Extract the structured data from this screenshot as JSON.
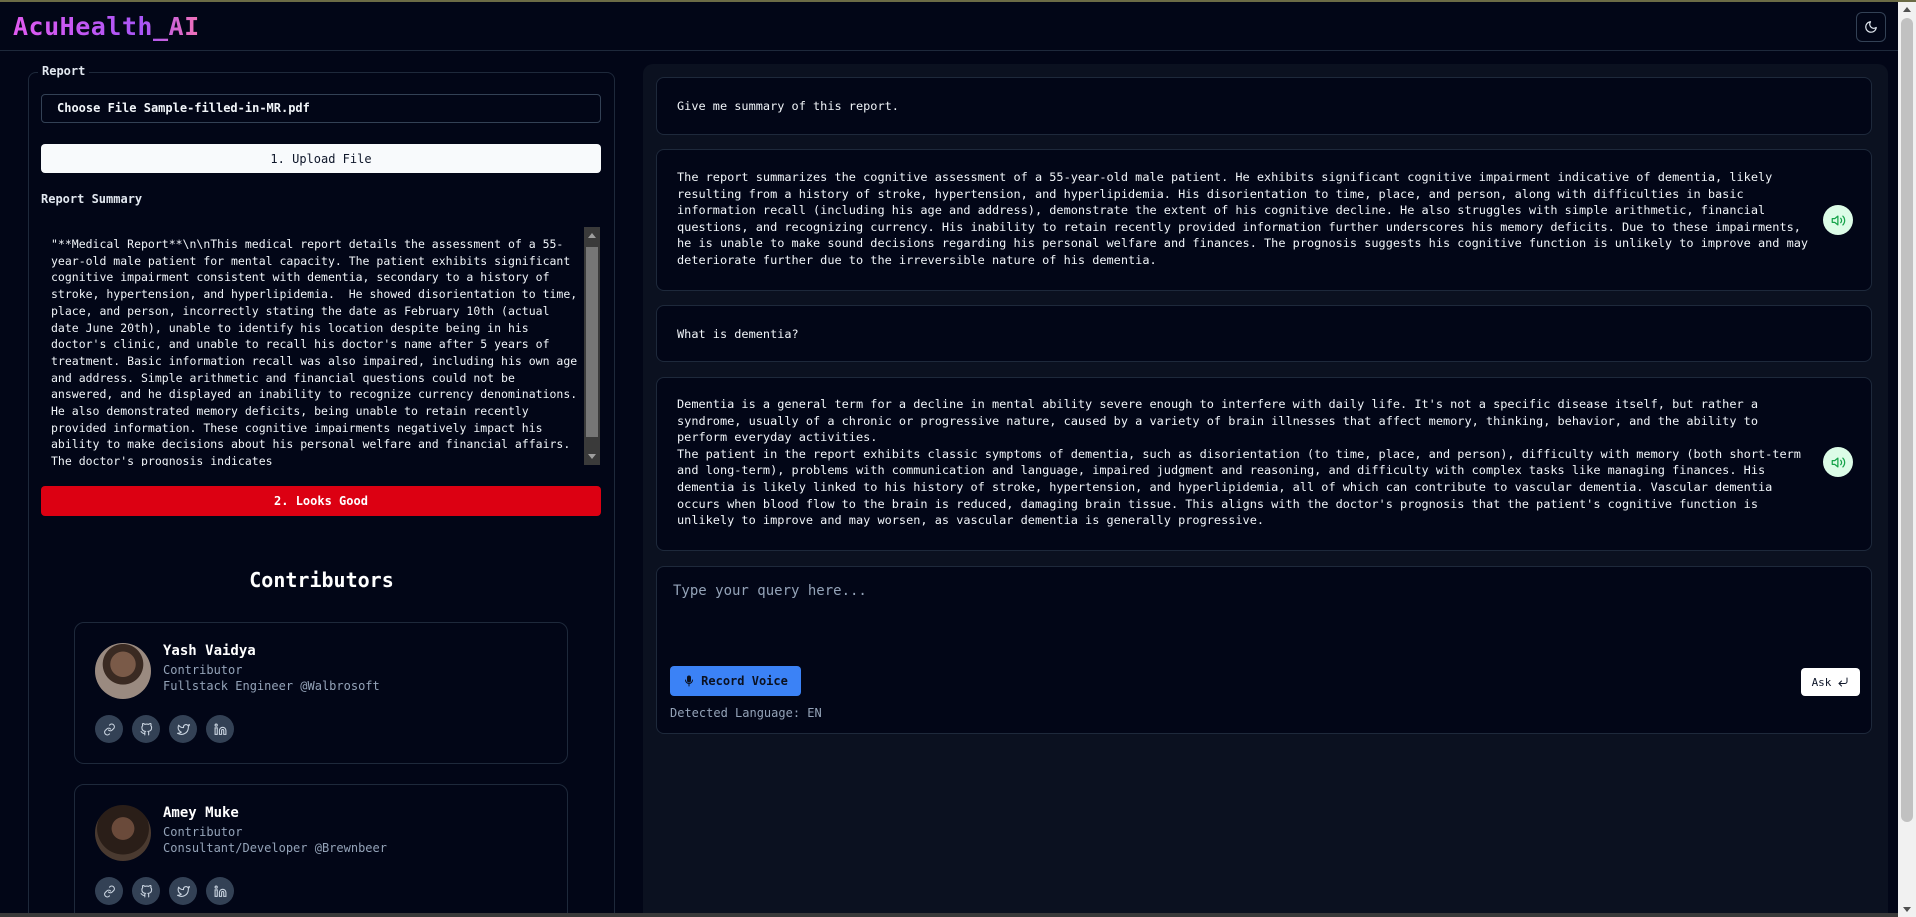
{
  "app": {
    "title": "AcuHealth_AI"
  },
  "header": {
    "theme_icon": "moon-icon"
  },
  "report": {
    "legend": "Report",
    "file_choose_label": "Choose File",
    "file_name": "Sample-filled-in-MR.pdf",
    "upload_label": "1. Upload File",
    "summary_label": "Report Summary",
    "summary_text": "\"**Medical Report**\\n\\nThis medical report details the assessment of a 55-year-old male patient for mental capacity. The patient exhibits significant cognitive impairment consistent with dementia, secondary to a history of stroke, hypertension, and hyperlipidemia.  He showed disorientation to time, place, and person, incorrectly stating the date as February 10th (actual date June 20th), unable to identify his location despite being in his doctor's clinic, and unable to recall his doctor's name after 5 years of treatment. Basic information recall was also impaired, including his own age and address. Simple arithmetic and financial questions could not be answered, and he displayed an inability to recognize currency denominations. He also demonstrated memory deficits, being unable to retain recently provided information. These cognitive impairments negatively impact his ability to make decisions about his personal welfare and financial affairs.  The doctor's prognosis indicates",
    "looks_good_label": "2. Looks Good"
  },
  "contributors": {
    "title": "Contributors",
    "people": [
      {
        "name": "Yash Vaidya",
        "role": "Contributor",
        "org": "Fullstack Engineer @Walbrosoft"
      },
      {
        "name": "Amey Muke",
        "role": "Contributor",
        "org": "Consultant/Developer @Brewnbeer"
      }
    ],
    "social_icons": [
      "link-icon",
      "github-icon",
      "twitter-icon",
      "linkedin-icon"
    ]
  },
  "chat": {
    "messages": [
      {
        "role": "user",
        "text": "Give me summary of this report."
      },
      {
        "role": "assistant",
        "text": "The report summarizes the cognitive assessment of a 55-year-old male patient. He exhibits significant cognitive impairment indicative of dementia, likely resulting from a history of stroke, hypertension, and hyperlipidemia. His disorientation to time, place, and person, along with difficulties in basic information recall (including his age and address), demonstrate the extent of his cognitive decline. He also struggles with simple arithmetic, financial questions, and recognizing currency. His inability to retain recently provided information further underscores his memory deficits. Due to these impairments, he is unable to make sound decisions regarding his personal welfare and finances. The prognosis suggests his cognitive function is unlikely to improve and may deteriorate further due to the irreversible nature of his dementia."
      },
      {
        "role": "user",
        "text": "What is dementia?"
      },
      {
        "role": "assistant",
        "text": "Dementia is a general term for a decline in mental ability severe enough to interfere with daily life. It's not a specific disease itself, but rather a syndrome, usually of a chronic or progressive nature, caused by a variety of brain illnesses that affect memory, thinking, behavior, and the ability to perform everyday activities.\nThe patient in the report exhibits classic symptoms of dementia, such as disorientation (to time, place, and person), difficulty with memory (both short-term and long-term), problems with communication and language, impaired judgment and reasoning, and difficulty with complex tasks like managing finances. His dementia is likely linked to his history of stroke, hypertension, and hyperlipidemia, all of which can contribute to vascular dementia. Vascular dementia occurs when blood flow to the brain is reduced, damaging brain tissue. This aligns with the doctor's prognosis that the patient's cognitive function is unlikely to improve and may worsen, as vascular dementia is generally progressive."
      }
    ],
    "query_placeholder": "Type your query here...",
    "record_label": "Record Voice",
    "ask_label": "Ask",
    "detected_language": "Detected Language: EN"
  },
  "colors": {
    "background": "#020617",
    "panel": "#0b1120",
    "looks_good": "#dc0012",
    "record": "#3b82f6",
    "speaker": "#dcfce7"
  }
}
